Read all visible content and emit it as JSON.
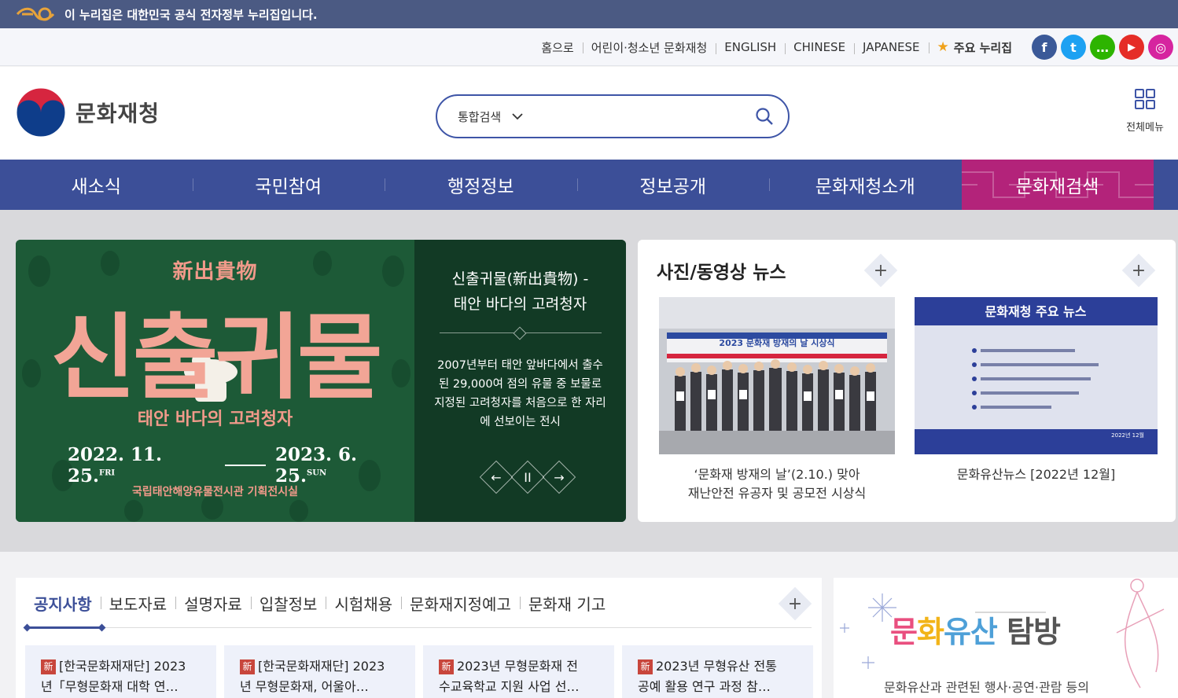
{
  "gov_banner": {
    "text": "이 누리집은 대한민국 공식 전자정부 누리집입니다."
  },
  "util": {
    "links": [
      "홈으로",
      "어린이·청소년 문화재청",
      "ENGLISH",
      "CHINESE",
      "JAPANESE"
    ],
    "favorite": "주요 누리집",
    "sns": [
      "f",
      "t",
      "…",
      "▶",
      "◎"
    ],
    "sns_colors": [
      "#3b5998",
      "#1da1f2",
      "#2db400",
      "#e52d27",
      "#d6249f"
    ]
  },
  "header": {
    "logo_text": "문화재청",
    "search_scope": "통합검색",
    "search_placeholder": "",
    "allmenu_label": "전체메뉴"
  },
  "gnb": [
    "새소식",
    "국민참여",
    "행정정보",
    "정보공개",
    "문화재청소개",
    "문화재검색"
  ],
  "banner": {
    "poster_hanja": "新出貴物",
    "poster_big": "신출귀물",
    "poster_sub": "태안 바다의 고려청자",
    "poster_date_start": "2022. 11. 25.",
    "poster_date_start_day": "FRI",
    "poster_date_end": "2023. 6. 25.",
    "poster_date_end_day": "SUN",
    "poster_venue": "국립태안해양유물전시관 기획전시실",
    "title_line1": "신출귀물(新出貴物) -",
    "title_line2": "태안 바다의 고려청자",
    "desc": "2007년부터 태안 앞바다에서 출수된 29,000여 점의 유물 중 보물로 지정된 고려청자를 처음으로 한 자리에 선보이는 전시",
    "controls": [
      "←",
      "II",
      "→"
    ]
  },
  "photo_news": {
    "title": "사진/동영상 뉴스",
    "items": [
      {
        "caption_line1": "‘문화재 방재의 날’(2.10.) 맞아",
        "caption_line2": "재난안전 유공자 및 공모전 시상식",
        "img_banner": "2023 문화재 방재의 날 시상식"
      },
      {
        "caption_line1": "문화유산뉴스 [2022년 12월]",
        "caption_line2": "",
        "img_title": "문화재청 주요 뉴스",
        "img_date": "2022년 12월"
      }
    ]
  },
  "notice": {
    "tabs": [
      "공지사항",
      "보도자료",
      "설명자료",
      "입찰정보",
      "시험채용",
      "문화재지정예고",
      "문화재 기고"
    ],
    "new_badge": "新",
    "cards": [
      {
        "line1": "[한국문화재재단] 2023",
        "line2": "년「무형문화재 대학 연…"
      },
      {
        "line1": "[한국문화재재단] 2023",
        "line2": "년 무형문화재, 어울아…"
      },
      {
        "line1": "2023년 무형문화재 전",
        "line2": "수교육학교 지원 사업 선…"
      },
      {
        "line1": "2023년 무형유산 전통",
        "line2": "공예 활용 연구 과정 참…"
      }
    ]
  },
  "side_banner": {
    "title_parts": [
      "문",
      "화",
      "유산",
      "탐방"
    ],
    "desc": "문화유산과 관련된 행사·공연·관람 등의"
  }
}
